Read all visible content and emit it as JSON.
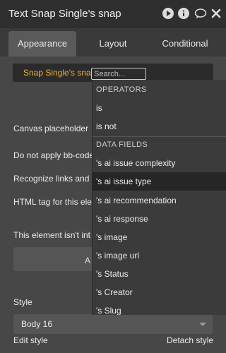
{
  "header": {
    "title": "Text Snap Single's snap",
    "icons": [
      "play-icon",
      "info-icon",
      "comment-icon",
      "close-icon"
    ]
  },
  "tabs": [
    {
      "label": "Appearance",
      "active": true
    },
    {
      "label": "Layout",
      "active": false
    },
    {
      "label": "Conditional",
      "active": false
    }
  ],
  "expression": {
    "text": "Snap Single's snap",
    "search_placeholder": "Search..."
  },
  "rows": {
    "canvas_placeholder": "Canvas placeholder",
    "no_bbcode": "Do not apply bb-code",
    "recognize_links": "Recognize links and e",
    "html_tag": "HTML tag for this ele",
    "not_interactive": "This element isn't int",
    "button_partial": "A"
  },
  "style": {
    "label": "Style",
    "value": "Body 16",
    "edit": "Edit style",
    "detach": "Detach style"
  },
  "help_label": "?",
  "dropdown": {
    "operators_header": "OPERATORS",
    "operators": [
      "is",
      "is not"
    ],
    "fields_header": "DATA FIELDS",
    "fields": [
      "'s ai issue complexity",
      "'s ai issue type",
      "'s ai recommendation",
      "'s ai response",
      "'s image",
      "'s image url",
      "'s Status",
      "'s Creator",
      "'s Slug"
    ],
    "highlighted": "'s ai issue type"
  },
  "colors": {
    "accent_yellow": "#f0b428",
    "panel": "#474747",
    "header": "#2f2f2f",
    "dropdown": "#3b3b3b"
  }
}
